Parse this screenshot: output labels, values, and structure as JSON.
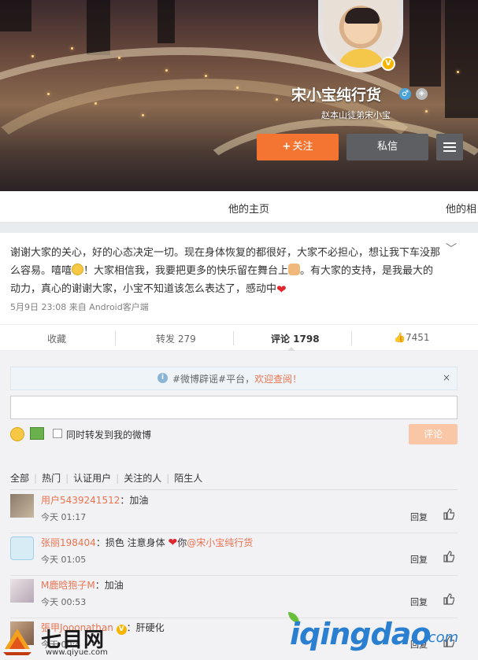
{
  "profile": {
    "name": "宋小宝纯行货",
    "bio": "赵本山徒弟宋小宝",
    "follow_label": "关注",
    "message_label": "私信",
    "accent": "#f37531"
  },
  "tabs": [
    "他的主页",
    "他的相"
  ],
  "post": {
    "text_1": "谢谢大家的关心，好的心态决定一切。现在身体恢复的都很好，大家不必担心，想让我下车没那么容易。嘻嘻",
    "text_2": "！大家相信我，我要把更多的快乐留在舞台上",
    "text_3": "。有大家的支持，是我最大的动力，真心的谢谢大家，小宝不知道该怎么表达了，感动中",
    "meta": "5月9日 23:08 来自 Android客户端"
  },
  "actions": {
    "favorite": "收藏",
    "repost": "转发 279",
    "comment": "评论 1798",
    "like": "7451"
  },
  "comment_box": {
    "notice_text": "#微博辟谣#平台，",
    "notice_link": "欢迎查阅！",
    "notice_close": "×",
    "also_repost": "同时转发到我的微博",
    "submit": "评论"
  },
  "filters": [
    "全部",
    "热门",
    "认证用户",
    "关注的人",
    "陌生人"
  ],
  "comments": [
    {
      "user": "用户5439241512",
      "text": "：加油",
      "time": "今天 01:17",
      "reply": "回复"
    },
    {
      "user": "张丽198404",
      "text": "：损色 注意身体",
      "text_after": "你",
      "mention": "@宋小宝纯行货",
      "time": "今天 01:05",
      "reply": "回复"
    },
    {
      "user": "M鹿晗狍子M",
      "text": "：加油",
      "time": "今天 00:53",
      "reply": "回复"
    },
    {
      "user": "張甲Jooonathan",
      "text": "：肝硬化",
      "time": "今天 00:4",
      "reply": "回复"
    }
  ],
  "watermarks": {
    "left_brand": "七目网",
    "left_url": "www.qiyue.com",
    "right_brand": "iqingdao",
    "right_com": ".com"
  }
}
